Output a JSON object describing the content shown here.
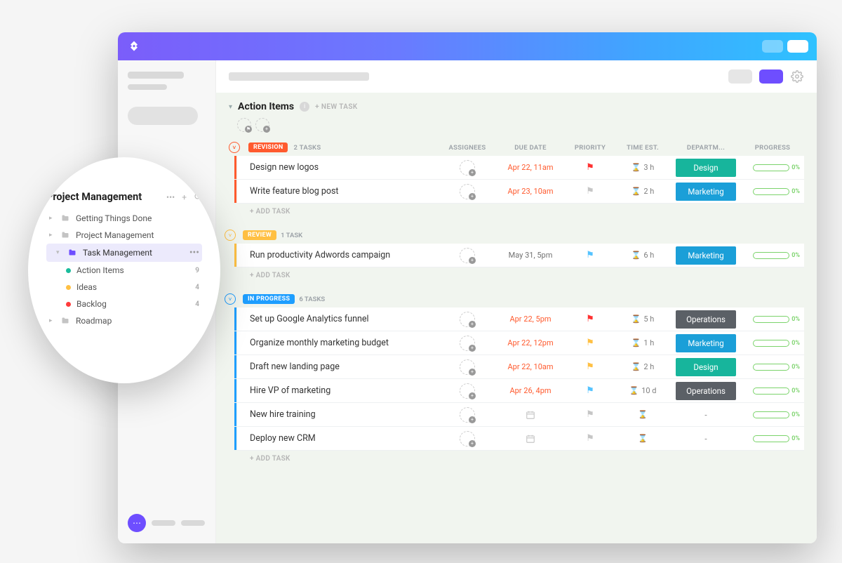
{
  "list": {
    "title": "Action Items",
    "new_task_label": "+ NEW TASK",
    "add_task_label": "+ ADD TASK"
  },
  "columns": {
    "assignees": "ASSIGNEES",
    "due_date": "DUE DATE",
    "priority": "PRIORITY",
    "time_est": "TIME EST.",
    "department": "DEPARTM...",
    "progress": "PROGRESS"
  },
  "groups": [
    {
      "status": "REVISION",
      "status_class": "revision",
      "count_label": "2 TASKS",
      "tasks": [
        {
          "name": "Design new logos",
          "due": "Apr 22, 11am",
          "due_class": "red",
          "flag": "red",
          "est": "3 h",
          "dept": "Design",
          "dept_class": "design",
          "progress": "0%"
        },
        {
          "name": "Write feature blog post",
          "due": "Apr 23, 10am",
          "due_class": "red",
          "flag": "grey",
          "est": "2 h",
          "dept": "Marketing",
          "dept_class": "marketing",
          "progress": "0%"
        }
      ]
    },
    {
      "status": "REVIEW",
      "status_class": "review",
      "count_label": "1 TASK",
      "tasks": [
        {
          "name": "Run productivity Adwords campaign",
          "due": "May 31, 5pm",
          "due_class": "grey",
          "flag": "blue",
          "est": "6 h",
          "dept": "Marketing",
          "dept_class": "marketing",
          "progress": "0%"
        }
      ]
    },
    {
      "status": "IN PROGRESS",
      "status_class": "inprogress",
      "count_label": "6 TASKS",
      "tasks": [
        {
          "name": "Set up Google Analytics funnel",
          "due": "Apr 22, 5pm",
          "due_class": "red",
          "flag": "red",
          "est": "5 h",
          "dept": "Operations",
          "dept_class": "operations",
          "progress": "0%"
        },
        {
          "name": "Organize monthly marketing budget",
          "due": "Apr 22, 12pm",
          "due_class": "red",
          "flag": "yellow",
          "est": "1 h",
          "dept": "Marketing",
          "dept_class": "marketing",
          "progress": "0%"
        },
        {
          "name": "Draft new landing page",
          "due": "Apr 22, 10am",
          "due_class": "red",
          "flag": "yellow",
          "est": "2 h",
          "dept": "Design",
          "dept_class": "design",
          "progress": "0%"
        },
        {
          "name": "Hire VP of marketing",
          "due": "Apr 26, 4pm",
          "due_class": "red",
          "flag": "blue",
          "est": "10 d",
          "dept": "Operations",
          "dept_class": "operations",
          "progress": "0%"
        },
        {
          "name": "New hire training",
          "due": "",
          "due_class": "empty",
          "flag": "grey",
          "est": "",
          "dept": "-",
          "dept_class": "none",
          "progress": "0%"
        },
        {
          "name": "Deploy new CRM",
          "due": "",
          "due_class": "empty",
          "flag": "grey",
          "est": "",
          "dept": "-",
          "dept_class": "none",
          "progress": "0%"
        }
      ]
    }
  ],
  "sidebar": {
    "title": "Project Management",
    "items": [
      {
        "type": "folder",
        "label": "Getting Things Done",
        "level": 0
      },
      {
        "type": "folder",
        "label": "Project Management",
        "level": 0
      },
      {
        "type": "folder",
        "label": "Task Management",
        "level": 1,
        "active": true,
        "count": ""
      },
      {
        "type": "dot",
        "dot": "green",
        "label": "Action Items",
        "level": 2,
        "count": "9"
      },
      {
        "type": "dot",
        "dot": "yellow",
        "label": "Ideas",
        "level": 2,
        "count": "4"
      },
      {
        "type": "dot",
        "dot": "red",
        "label": "Backlog",
        "level": 2,
        "count": "4"
      },
      {
        "type": "folder",
        "label": "Roadmap",
        "level": 0
      }
    ]
  }
}
